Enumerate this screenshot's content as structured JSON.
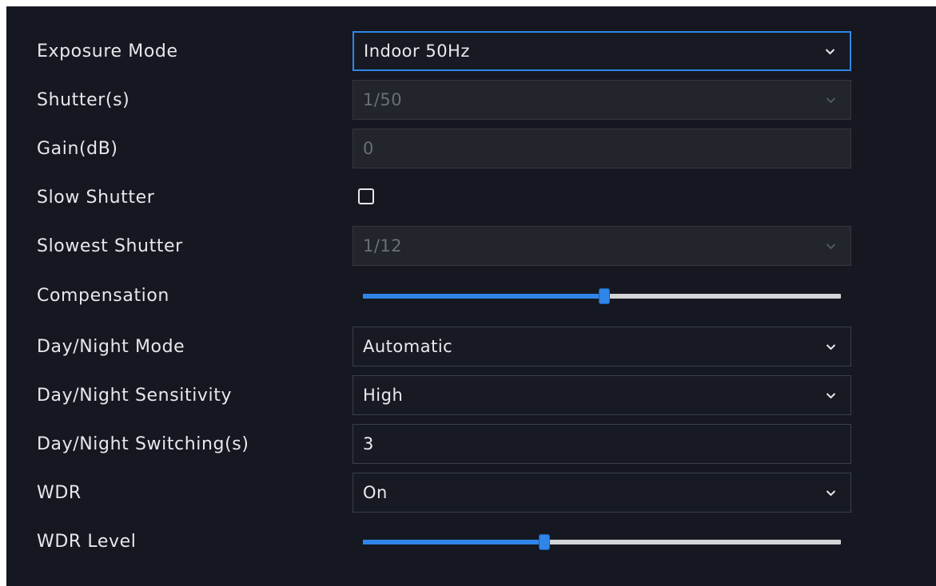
{
  "exposure_settings": {
    "exposure_mode": {
      "label": "Exposure Mode",
      "value": "Indoor 50Hz"
    },
    "shutter": {
      "label": "Shutter(s)",
      "value": "1/50"
    },
    "gain": {
      "label": "Gain(dB)",
      "value": "0"
    },
    "slow_shutter": {
      "label": "Slow Shutter",
      "checked": false
    },
    "slowest_shutter": {
      "label": "Slowest Shutter",
      "value": "1/12"
    },
    "compensation": {
      "label": "Compensation",
      "level_fraction": 0.505
    },
    "day_night_mode": {
      "label": "Day/Night Mode",
      "value": "Automatic"
    },
    "day_night_sensitivity": {
      "label": "Day/Night Sensitivity",
      "value": "High"
    },
    "day_night_switching": {
      "label": "Day/Night Switching(s)",
      "value": "3"
    },
    "wdr": {
      "label": "WDR",
      "value": "On"
    },
    "wdr_level": {
      "label": "WDR Level",
      "level_fraction": 0.38
    }
  },
  "colors": {
    "background": "#151820",
    "accent": "#2f86e8",
    "text": "#e6e8ec",
    "disabled_text": "#6a6e76"
  },
  "icons": {
    "dropdown": "chevron-down-icon"
  }
}
